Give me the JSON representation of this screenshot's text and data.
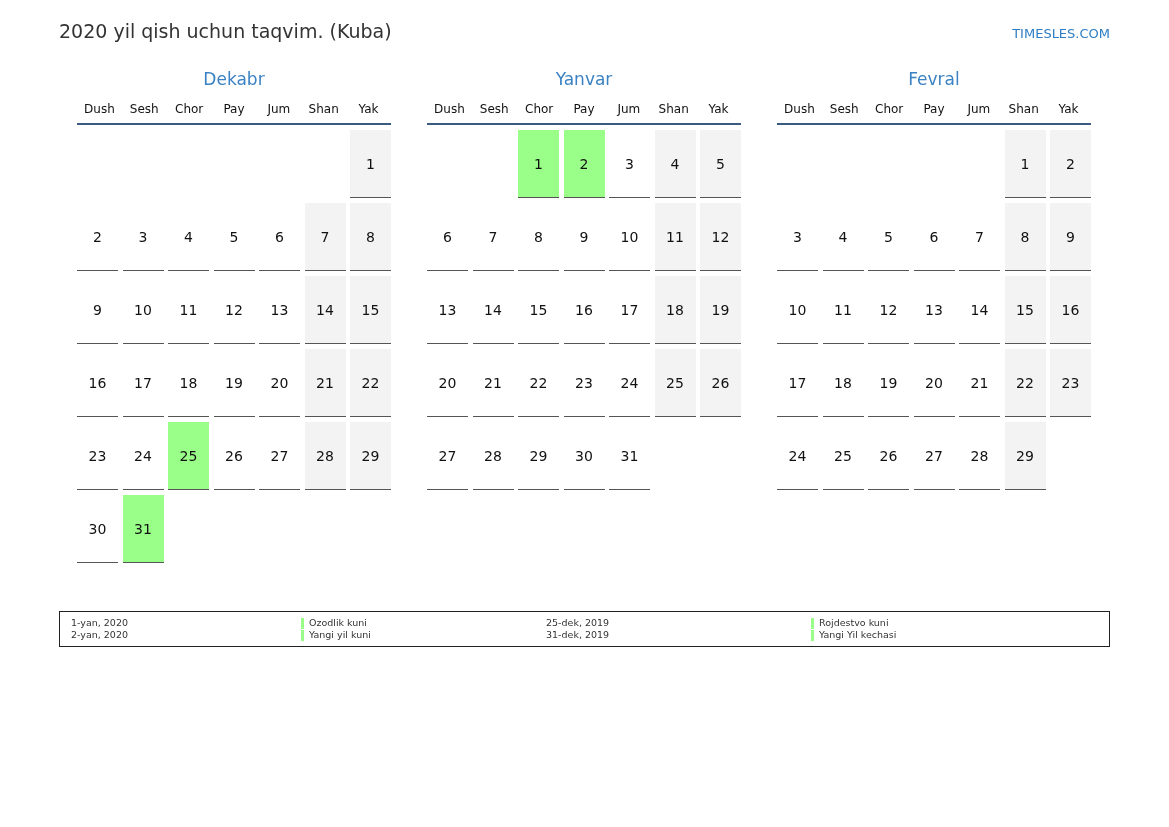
{
  "title": "2020 yil qish uchun taqvim. (Kuba)",
  "site_link": "TIMESLES.COM",
  "months": [
    {
      "name": "Dekabr",
      "weekdays": [
        "Dush",
        "Sesh",
        "Chor",
        "Pay",
        "Jum",
        "Shan",
        "Yak"
      ],
      "weeks": [
        [
          {
            "kind": "empty"
          },
          {
            "kind": "empty"
          },
          {
            "kind": "empty"
          },
          {
            "kind": "empty"
          },
          {
            "kind": "empty"
          },
          {
            "kind": "empty"
          },
          {
            "kind": "day",
            "day": "1",
            "weekend": true,
            "holiday": false
          }
        ],
        [
          {
            "kind": "day",
            "day": "2",
            "weekend": false,
            "holiday": false
          },
          {
            "kind": "day",
            "day": "3",
            "weekend": false,
            "holiday": false
          },
          {
            "kind": "day",
            "day": "4",
            "weekend": false,
            "holiday": false
          },
          {
            "kind": "day",
            "day": "5",
            "weekend": false,
            "holiday": false
          },
          {
            "kind": "day",
            "day": "6",
            "weekend": false,
            "holiday": false
          },
          {
            "kind": "day",
            "day": "7",
            "weekend": true,
            "holiday": false
          },
          {
            "kind": "day",
            "day": "8",
            "weekend": true,
            "holiday": false
          }
        ],
        [
          {
            "kind": "day",
            "day": "9",
            "weekend": false,
            "holiday": false
          },
          {
            "kind": "day",
            "day": "10",
            "weekend": false,
            "holiday": false
          },
          {
            "kind": "day",
            "day": "11",
            "weekend": false,
            "holiday": false
          },
          {
            "kind": "day",
            "day": "12",
            "weekend": false,
            "holiday": false
          },
          {
            "kind": "day",
            "day": "13",
            "weekend": false,
            "holiday": false
          },
          {
            "kind": "day",
            "day": "14",
            "weekend": true,
            "holiday": false
          },
          {
            "kind": "day",
            "day": "15",
            "weekend": true,
            "holiday": false
          }
        ],
        [
          {
            "kind": "day",
            "day": "16",
            "weekend": false,
            "holiday": false
          },
          {
            "kind": "day",
            "day": "17",
            "weekend": false,
            "holiday": false
          },
          {
            "kind": "day",
            "day": "18",
            "weekend": false,
            "holiday": false
          },
          {
            "kind": "day",
            "day": "19",
            "weekend": false,
            "holiday": false
          },
          {
            "kind": "day",
            "day": "20",
            "weekend": false,
            "holiday": false
          },
          {
            "kind": "day",
            "day": "21",
            "weekend": true,
            "holiday": false
          },
          {
            "kind": "day",
            "day": "22",
            "weekend": true,
            "holiday": false
          }
        ],
        [
          {
            "kind": "day",
            "day": "23",
            "weekend": false,
            "holiday": false
          },
          {
            "kind": "day",
            "day": "24",
            "weekend": false,
            "holiday": false
          },
          {
            "kind": "day",
            "day": "25",
            "weekend": false,
            "holiday": true
          },
          {
            "kind": "day",
            "day": "26",
            "weekend": false,
            "holiday": false
          },
          {
            "kind": "day",
            "day": "27",
            "weekend": false,
            "holiday": false
          },
          {
            "kind": "day",
            "day": "28",
            "weekend": true,
            "holiday": false
          },
          {
            "kind": "day",
            "day": "29",
            "weekend": true,
            "holiday": false
          }
        ],
        [
          {
            "kind": "day",
            "day": "30",
            "weekend": false,
            "holiday": false
          },
          {
            "kind": "day",
            "day": "31",
            "weekend": false,
            "holiday": true
          }
        ]
      ]
    },
    {
      "name": "Yanvar",
      "weekdays": [
        "Dush",
        "Sesh",
        "Chor",
        "Pay",
        "Jum",
        "Shan",
        "Yak"
      ],
      "weeks": [
        [
          {
            "kind": "empty"
          },
          {
            "kind": "empty"
          },
          {
            "kind": "day",
            "day": "1",
            "weekend": false,
            "holiday": true
          },
          {
            "kind": "day",
            "day": "2",
            "weekend": false,
            "holiday": true
          },
          {
            "kind": "day",
            "day": "3",
            "weekend": false,
            "holiday": false
          },
          {
            "kind": "day",
            "day": "4",
            "weekend": true,
            "holiday": false
          },
          {
            "kind": "day",
            "day": "5",
            "weekend": true,
            "holiday": false
          }
        ],
        [
          {
            "kind": "day",
            "day": "6",
            "weekend": false,
            "holiday": false
          },
          {
            "kind": "day",
            "day": "7",
            "weekend": false,
            "holiday": false
          },
          {
            "kind": "day",
            "day": "8",
            "weekend": false,
            "holiday": false
          },
          {
            "kind": "day",
            "day": "9",
            "weekend": false,
            "holiday": false
          },
          {
            "kind": "day",
            "day": "10",
            "weekend": false,
            "holiday": false
          },
          {
            "kind": "day",
            "day": "11",
            "weekend": true,
            "holiday": false
          },
          {
            "kind": "day",
            "day": "12",
            "weekend": true,
            "holiday": false
          }
        ],
        [
          {
            "kind": "day",
            "day": "13",
            "weekend": false,
            "holiday": false
          },
          {
            "kind": "day",
            "day": "14",
            "weekend": false,
            "holiday": false
          },
          {
            "kind": "day",
            "day": "15",
            "weekend": false,
            "holiday": false
          },
          {
            "kind": "day",
            "day": "16",
            "weekend": false,
            "holiday": false
          },
          {
            "kind": "day",
            "day": "17",
            "weekend": false,
            "holiday": false
          },
          {
            "kind": "day",
            "day": "18",
            "weekend": true,
            "holiday": false
          },
          {
            "kind": "day",
            "day": "19",
            "weekend": true,
            "holiday": false
          }
        ],
        [
          {
            "kind": "day",
            "day": "20",
            "weekend": false,
            "holiday": false
          },
          {
            "kind": "day",
            "day": "21",
            "weekend": false,
            "holiday": false
          },
          {
            "kind": "day",
            "day": "22",
            "weekend": false,
            "holiday": false
          },
          {
            "kind": "day",
            "day": "23",
            "weekend": false,
            "holiday": false
          },
          {
            "kind": "day",
            "day": "24",
            "weekend": false,
            "holiday": false
          },
          {
            "kind": "day",
            "day": "25",
            "weekend": true,
            "holiday": false
          },
          {
            "kind": "day",
            "day": "26",
            "weekend": true,
            "holiday": false
          }
        ],
        [
          {
            "kind": "day",
            "day": "27",
            "weekend": false,
            "holiday": false
          },
          {
            "kind": "day",
            "day": "28",
            "weekend": false,
            "holiday": false
          },
          {
            "kind": "day",
            "day": "29",
            "weekend": false,
            "holiday": false
          },
          {
            "kind": "day",
            "day": "30",
            "weekend": false,
            "holiday": false
          },
          {
            "kind": "day",
            "day": "31",
            "weekend": false,
            "holiday": false
          }
        ]
      ]
    },
    {
      "name": "Fevral",
      "weekdays": [
        "Dush",
        "Sesh",
        "Chor",
        "Pay",
        "Jum",
        "Shan",
        "Yak"
      ],
      "weeks": [
        [
          {
            "kind": "empty"
          },
          {
            "kind": "empty"
          },
          {
            "kind": "empty"
          },
          {
            "kind": "empty"
          },
          {
            "kind": "empty"
          },
          {
            "kind": "day",
            "day": "1",
            "weekend": true,
            "holiday": false
          },
          {
            "kind": "day",
            "day": "2",
            "weekend": true,
            "holiday": false
          }
        ],
        [
          {
            "kind": "day",
            "day": "3",
            "weekend": false,
            "holiday": false
          },
          {
            "kind": "day",
            "day": "4",
            "weekend": false,
            "holiday": false
          },
          {
            "kind": "day",
            "day": "5",
            "weekend": false,
            "holiday": false
          },
          {
            "kind": "day",
            "day": "6",
            "weekend": false,
            "holiday": false
          },
          {
            "kind": "day",
            "day": "7",
            "weekend": false,
            "holiday": false
          },
          {
            "kind": "day",
            "day": "8",
            "weekend": true,
            "holiday": false
          },
          {
            "kind": "day",
            "day": "9",
            "weekend": true,
            "holiday": false
          }
        ],
        [
          {
            "kind": "day",
            "day": "10",
            "weekend": false,
            "holiday": false
          },
          {
            "kind": "day",
            "day": "11",
            "weekend": false,
            "holiday": false
          },
          {
            "kind": "day",
            "day": "12",
            "weekend": false,
            "holiday": false
          },
          {
            "kind": "day",
            "day": "13",
            "weekend": false,
            "holiday": false
          },
          {
            "kind": "day",
            "day": "14",
            "weekend": false,
            "holiday": false
          },
          {
            "kind": "day",
            "day": "15",
            "weekend": true,
            "holiday": false
          },
          {
            "kind": "day",
            "day": "16",
            "weekend": true,
            "holiday": false
          }
        ],
        [
          {
            "kind": "day",
            "day": "17",
            "weekend": false,
            "holiday": false
          },
          {
            "kind": "day",
            "day": "18",
            "weekend": false,
            "holiday": false
          },
          {
            "kind": "day",
            "day": "19",
            "weekend": false,
            "holiday": false
          },
          {
            "kind": "day",
            "day": "20",
            "weekend": false,
            "holiday": false
          },
          {
            "kind": "day",
            "day": "21",
            "weekend": false,
            "holiday": false
          },
          {
            "kind": "day",
            "day": "22",
            "weekend": true,
            "holiday": false
          },
          {
            "kind": "day",
            "day": "23",
            "weekend": true,
            "holiday": false
          }
        ],
        [
          {
            "kind": "day",
            "day": "24",
            "weekend": false,
            "holiday": false
          },
          {
            "kind": "day",
            "day": "25",
            "weekend": false,
            "holiday": false
          },
          {
            "kind": "day",
            "day": "26",
            "weekend": false,
            "holiday": false
          },
          {
            "kind": "day",
            "day": "27",
            "weekend": false,
            "holiday": false
          },
          {
            "kind": "day",
            "day": "28",
            "weekend": false,
            "holiday": false
          },
          {
            "kind": "day",
            "day": "29",
            "weekend": true,
            "holiday": false
          }
        ]
      ]
    }
  ],
  "legend": [
    {
      "date": "1-yan, 2020",
      "name": "Ozodlik kuni",
      "color": "#99ff88"
    },
    {
      "date": "2-yan, 2020",
      "name": "Yangi yil kuni",
      "color": "#99ff88"
    },
    {
      "date": "25-dek, 2019",
      "name": "Rojdestvo kuni",
      "color": "#99ff88"
    },
    {
      "date": "31-dek, 2019",
      "name": "Yangi Yil kechasi",
      "color": "#99ff88"
    }
  ]
}
